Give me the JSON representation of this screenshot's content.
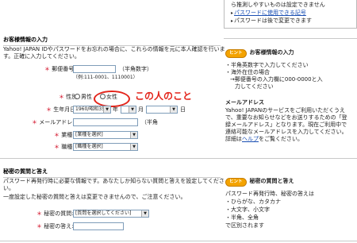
{
  "top_right": {
    "line1": "ら推測しやすいものは設定できません",
    "bullet1": "パスワードに使用できる記号",
    "bullet2": "パスワードは後で変更できます"
  },
  "customer_info": {
    "heading": "お客様情報の入力",
    "intro1": "Yahoo! JAPAN IDやパスワードをお忘れの場合に、これらの情報を元に本人確認を行いま",
    "intro2": "す。正確に入力してください。",
    "postal_label": "郵便番号:",
    "postal_value": "",
    "postal_hint": "（半角数字）",
    "postal_example": "（例:111-0001、1110001）",
    "gender_label": "性別:",
    "gender_male": "男性",
    "gender_female": "女性",
    "birth_label": "生年月日:",
    "birth_year": "1960/昭和35",
    "year_unit": "年",
    "month_unit": "月",
    "day_unit": "日",
    "email_label": "メールアドレス:",
    "email_value": "",
    "email_suffix": "（半角",
    "industry_label": "業種:",
    "industry_value": "[業種を選択]",
    "occupation_label": "職種:",
    "occupation_value": "[職種を選択]",
    "required_mark": "＊"
  },
  "annotation": {
    "text": "この人のこと"
  },
  "help_customer": {
    "badge": "ヒント",
    "title": "お客様情報の入力",
    "b1": "・半角英数字で入力してください",
    "b2": "・海外在住の場合",
    "b3": "→郵便番号の入力欄に000-0000と入",
    "b4": "力してください",
    "mail_title": "メールアドレス",
    "m1": "Yahoo! JAPANのサービスをご利用いただくうえ",
    "m2": "で、重要なお知らせなどをお送りするための「登",
    "m3": "録メールアドレス」となります。現在ご利用中で",
    "m4": "連絡可能なメールアドレスを入力してください。",
    "m5_pre": "詳細は",
    "m5_link": "ヘルプ",
    "m5_post": "をご覧ください。"
  },
  "secret": {
    "heading": "秘密の質問と答え",
    "intro1": "パスワード再発行時に必要な情報です。あなたしか知らない質問と答えを設定してくださ",
    "intro2": "い。",
    "intro3": "一度設定した秘密の質問と答えは変更できませんので、ご注意ください。",
    "question_label": "秘密の質問:",
    "question_value": "[質問を選択してください]",
    "answer_label": "秘密の答え:",
    "answer_value": ""
  },
  "help_secret": {
    "badge": "ヒント",
    "title": "秘密の質問と答え",
    "s1": "パスワード再発行時、秘密の答えは",
    "s2": "・ひらがな、カタカナ",
    "s3": "・大文字、小文字",
    "s4": "・半角、全角",
    "s5": "で区別されます"
  },
  "colors": {
    "accent_red": "#e3241a",
    "link_blue": "#1a4fb3",
    "hint_orange": "#f4a300"
  }
}
